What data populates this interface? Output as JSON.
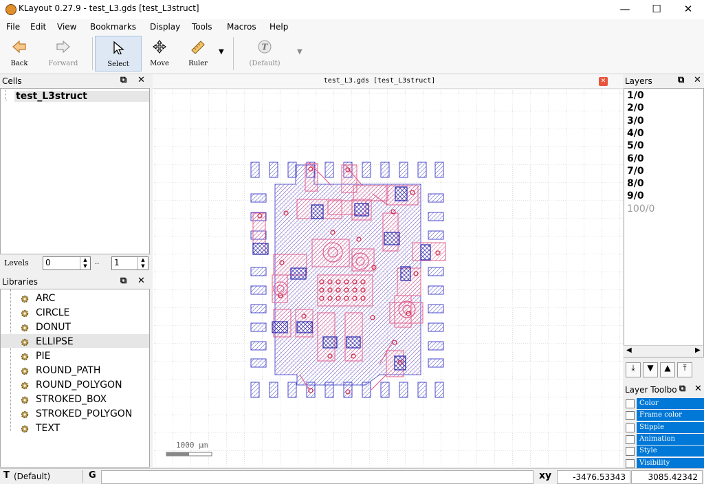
{
  "window": {
    "title": "KLayout 0.27.9 - test_L3.gds [test_L3struct]",
    "minimize": "—",
    "maximize": "☐",
    "close": "✕"
  },
  "menu": [
    "File",
    "Edit",
    "View",
    "Bookmarks",
    "Display",
    "Tools",
    "Macros",
    "Help"
  ],
  "toolbar": {
    "back": "Back",
    "forward": "Forward",
    "select": "Select",
    "move": "Move",
    "ruler": "Ruler",
    "text_default": "(Default)"
  },
  "cells": {
    "title": "Cells",
    "root": "test_L3struct",
    "levels_label": "Levels",
    "level_from": "0",
    "level_sep": "..",
    "level_to": "1"
  },
  "libraries": {
    "title": "Libraries",
    "items": [
      "ARC",
      "CIRCLE",
      "DONUT",
      "ELLIPSE",
      "PIE",
      "ROUND_PATH",
      "ROUND_POLYGON",
      "STROKED_BOX",
      "STROKED_POLYGON",
      "TEXT"
    ]
  },
  "canvas": {
    "tab_title": "test_L3.gds [test_L3struct]",
    "scale_label": "1000 µm"
  },
  "layers": {
    "title": "Layers",
    "items": [
      "1/0",
      "2/0",
      "3/0",
      "4/0",
      "5/0",
      "6/0",
      "7/0",
      "8/0",
      "9/0",
      "100/0"
    ]
  },
  "layer_toolbox": {
    "title": "Layer Toolbo",
    "rows": [
      "Color",
      "Frame color",
      "Stipple",
      "Animation",
      "Style",
      "Visibility"
    ]
  },
  "status": {
    "text_icon": "T",
    "text_default": "(Default)",
    "grid_icon": "G",
    "xy_label": "xy",
    "x": "-3476.53343",
    "y": "3085.42342"
  },
  "colors": {
    "accent": "#0078d7",
    "layer_blue": "#4a4acc",
    "layer_pink": "#e06090",
    "layer_red": "#d02040"
  }
}
